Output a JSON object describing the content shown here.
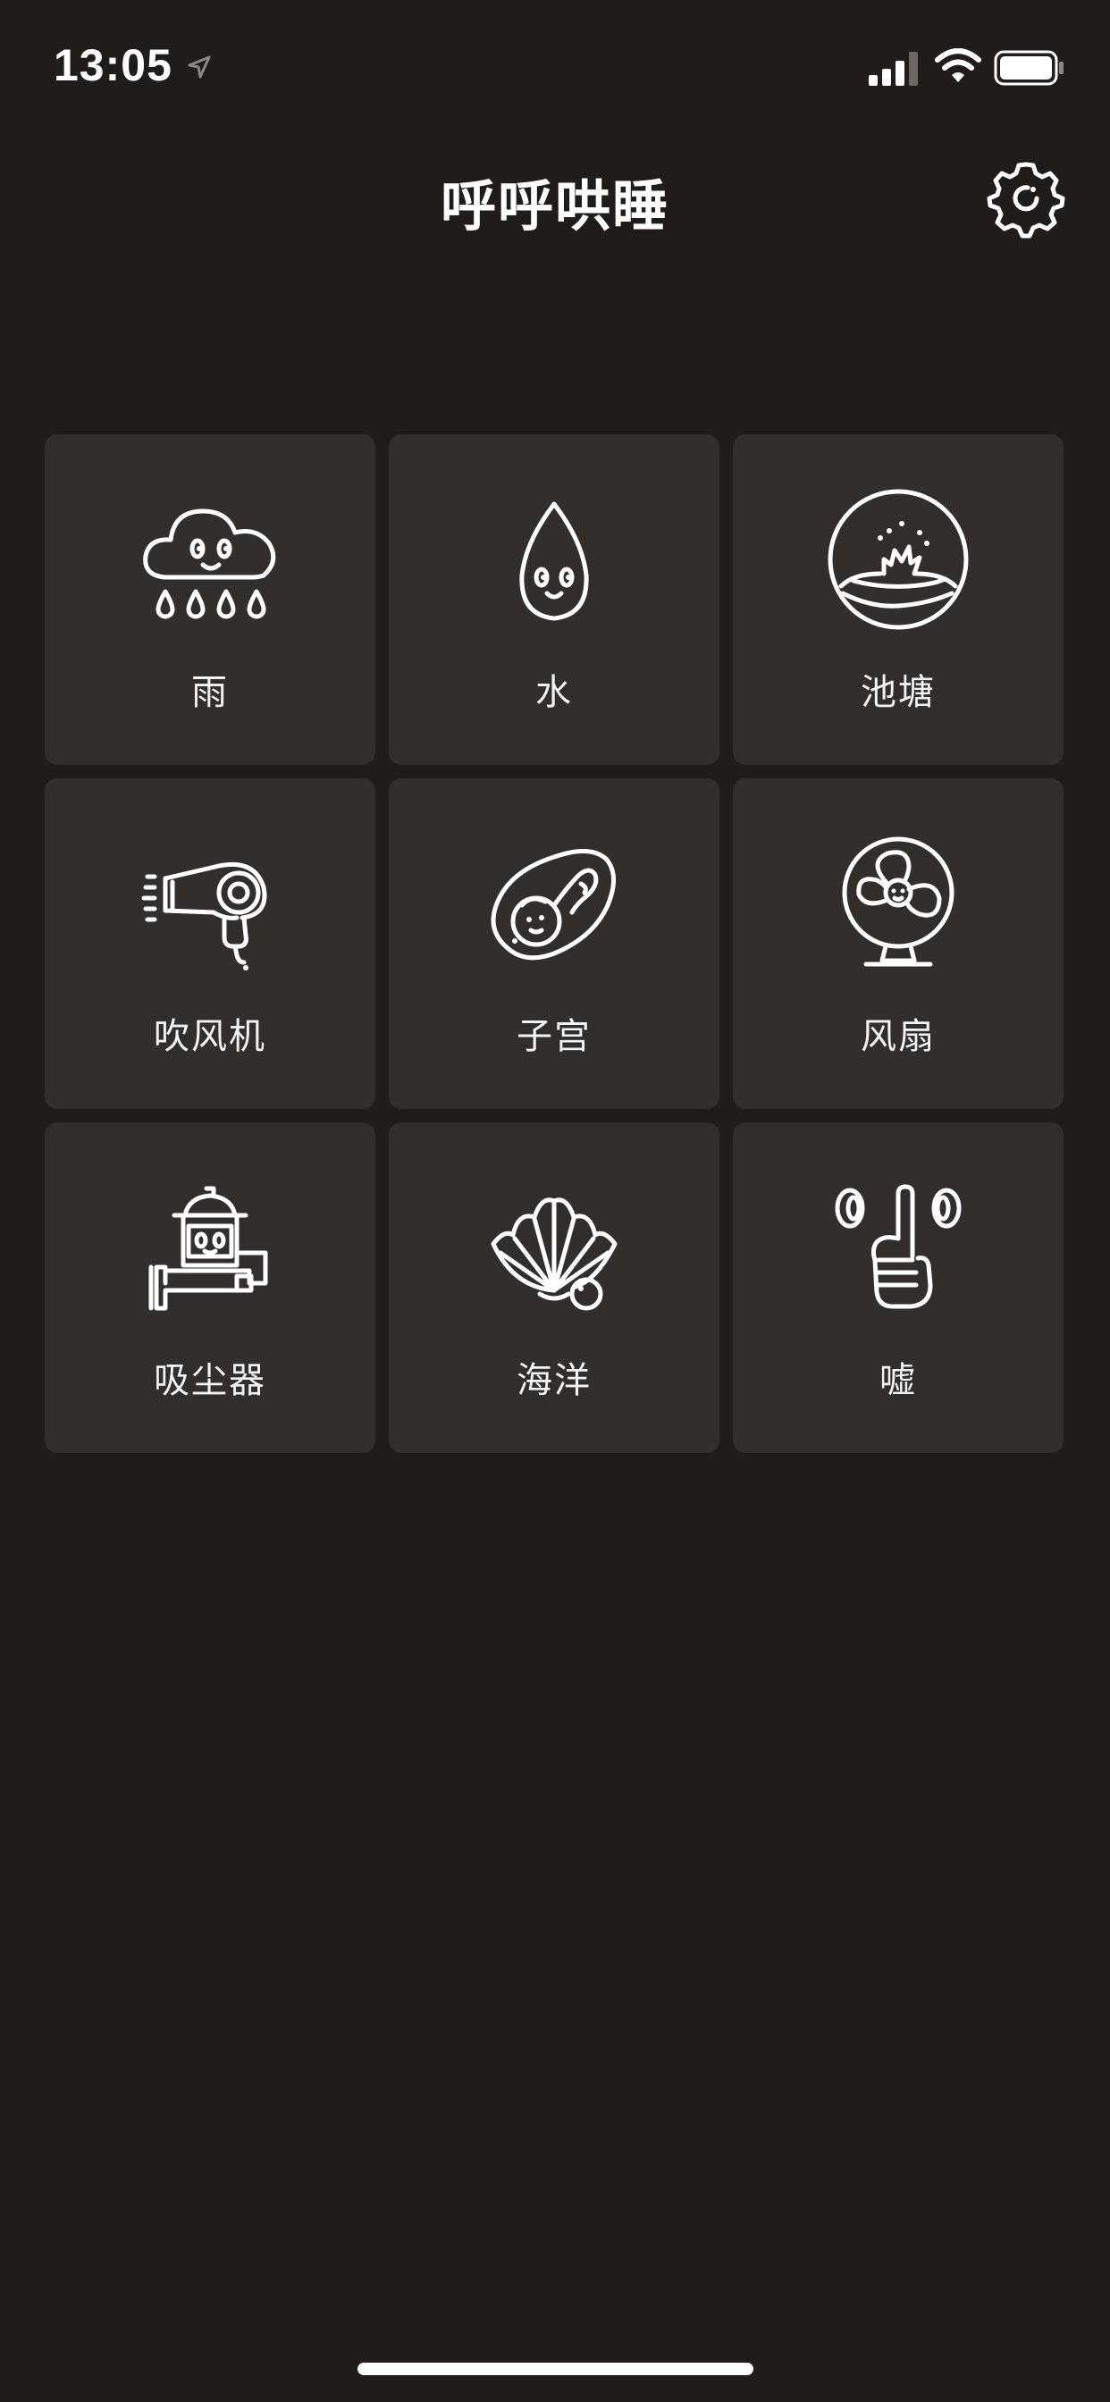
{
  "status_bar": {
    "time": "13:05"
  },
  "header": {
    "title": "呼呼哄睡"
  },
  "sounds": [
    {
      "label": "雨",
      "icon": "rain-cloud-icon"
    },
    {
      "label": "水",
      "icon": "water-drop-icon"
    },
    {
      "label": "池塘",
      "icon": "pond-icon"
    },
    {
      "label": "吹风机",
      "icon": "hair-dryer-icon"
    },
    {
      "label": "子宫",
      "icon": "womb-icon"
    },
    {
      "label": "风扇",
      "icon": "fan-icon"
    },
    {
      "label": "吸尘器",
      "icon": "vacuum-cleaner-icon"
    },
    {
      "label": "海洋",
      "icon": "seashell-icon"
    },
    {
      "label": "嘘",
      "icon": "shush-icon"
    }
  ],
  "colors": {
    "background": "#1f1c19",
    "tile": "#312e2b",
    "foreground": "#ffffff"
  }
}
